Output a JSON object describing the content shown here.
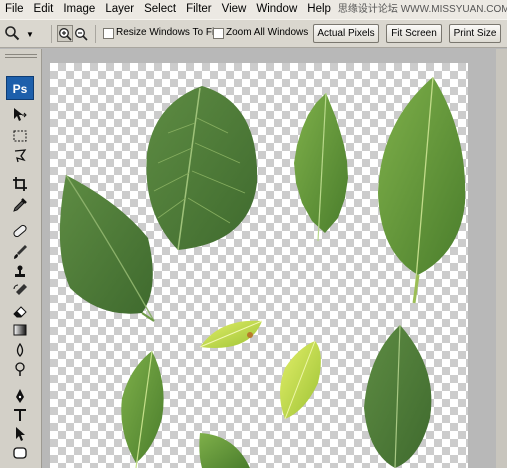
{
  "menu": {
    "items": [
      "File",
      "Edit",
      "Image",
      "Layer",
      "Select",
      "Filter",
      "View",
      "Window",
      "Help"
    ],
    "watermark": "思缘设计论坛  WWW.MISSYUAN.COM"
  },
  "options": {
    "resize_windows_label": "Resize Windows To Fit",
    "zoom_all_label": "Zoom All Windows",
    "actual_pixels_label": "Actual Pixels",
    "fit_screen_label": "Fit Screen",
    "print_size_label": "Print Size"
  },
  "toolbox": {
    "logo": "Ps",
    "tools": [
      "move-icon",
      "marquee-icon",
      "lasso-icon",
      "crop-icon",
      "eyedropper-icon",
      "healing-icon",
      "brush-icon",
      "stamp-icon",
      "history-brush-icon",
      "eraser-icon",
      "gradient-icon",
      "blur-icon",
      "dodge-icon",
      "pen-icon",
      "type-icon",
      "path-select-icon",
      "shape-icon"
    ]
  },
  "colors": {
    "checker_dark": "#cccccc",
    "dark_leaf": "#4f7a3a",
    "mid_leaf": "#5f8f3a",
    "light_leaf": "#c8dd3f"
  }
}
